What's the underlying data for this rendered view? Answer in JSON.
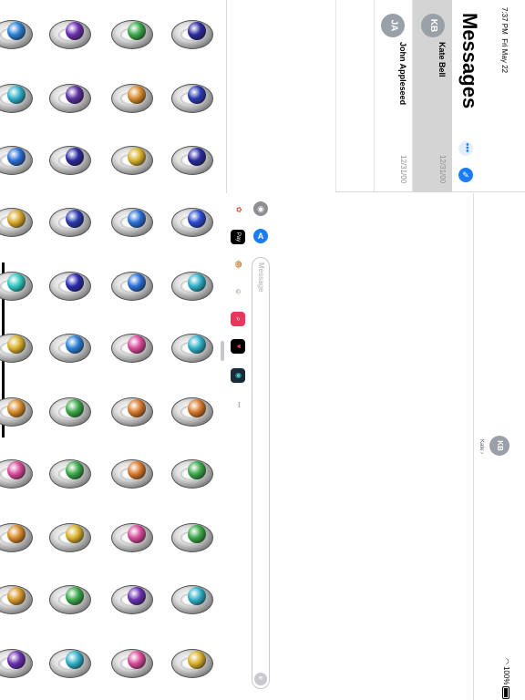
{
  "status": {
    "time": "7:37 PM",
    "date": "Fri May 22",
    "battery": "100%"
  },
  "sidebar": {
    "title": "Messages",
    "more_label": "•••",
    "compose_label": "✎",
    "conversations": [
      {
        "initials": "KB",
        "name": "Kate Bell",
        "date": "12/31/00",
        "selected": true
      },
      {
        "initials": "JA",
        "name": "John Appleseed",
        "date": "12/31/00",
        "selected": false
      }
    ]
  },
  "conversation": {
    "contact_initials": "KB",
    "contact_name": "Kate ›"
  },
  "compose": {
    "placeholder": "Message",
    "camera_icon": "camera-icon",
    "appstore_icon": "app-store-icon",
    "audio_icon": "audio-waveform-icon"
  },
  "app_drawer": [
    {
      "name": "photos-app-icon",
      "glyph": "✿",
      "color": "#ffffff",
      "fg": "#e0533b"
    },
    {
      "name": "apple-pay-icon",
      "glyph": "Pay",
      "color": "#000000",
      "fg": "#ffffff"
    },
    {
      "name": "animoji-icon",
      "glyph": "🐵",
      "color": "#ffffff",
      "fg": "#000000"
    },
    {
      "name": "memoji-icon",
      "glyph": "☺",
      "color": "#ffffff",
      "fg": "#7b4a2a"
    },
    {
      "name": "web-images-search-icon",
      "glyph": "⌕",
      "color": "#e8365d",
      "fg": "#ffffff"
    },
    {
      "name": "digital-touch-icon",
      "glyph": "♥",
      "color": "#000000",
      "fg": "#e8365d"
    },
    {
      "name": "sticker-app-icon",
      "glyph": "◉",
      "color": "#1a2a3a",
      "fg": "#3fd0c0"
    },
    {
      "name": "more-apps-icon",
      "glyph": "•••",
      "color": "#ffffff",
      "fg": "#8e8e93"
    }
  ],
  "stickers": {
    "gem_colors": [
      [
        "#2a7fd6",
        "#6a2fb0",
        "#3aa84a",
        "#2a2aa0"
      ],
      [
        "#2fb0c8",
        "#5a2fa0",
        "#d88a2a",
        "#2a3ab0"
      ],
      [
        "#2a6fd6",
        "#2a2aa0",
        "#d8b02a",
        "#2a2aa0"
      ],
      [
        "#d8a82a",
        "#2a3ab0",
        "#2a6fd6",
        "#2a4ad0"
      ],
      [
        "#2fc8c0",
        "#2a2ab0",
        "#2a6fd6",
        "#2fb0c8"
      ],
      [
        "#d8b02a",
        "#2a7fd6",
        "#d84a9a",
        "#2fb0c8"
      ],
      [
        "#d88a2a",
        "#3aa84a",
        "#d8782a",
        "#d8782a"
      ],
      [
        "#d84a9a",
        "#3aa84a",
        "#d8782a",
        "#3aa84a"
      ],
      [
        "#d88a2a",
        "#d8b02a",
        "#d84a9a",
        "#3aa84a"
      ],
      [
        "#d8982a",
        "#3aa84a",
        "#6a2fb0",
        "#2fb0c8"
      ],
      [
        "#6a2fb0",
        "#2fb0c8",
        "#d84a9a",
        "#d8b02a"
      ]
    ]
  }
}
